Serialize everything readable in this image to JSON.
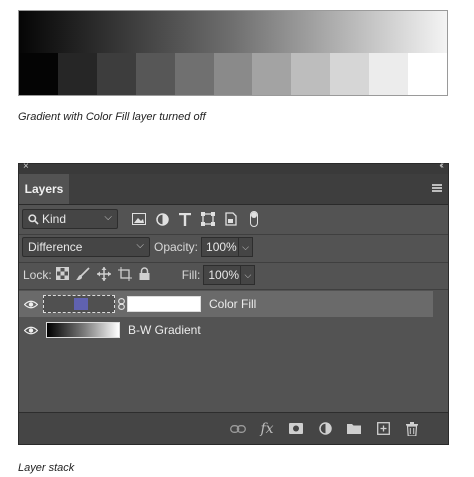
{
  "figure": {
    "caption_top": "Gradient with Color Fill layer turned off",
    "caption_bottom": "Layer stack",
    "swatches": [
      "#040404",
      "#262626",
      "#3d3d3d",
      "#575757",
      "#707070",
      "#8a8a8a",
      "#a3a3a3",
      "#bdbdbd",
      "#d6d6d6",
      "#ececec",
      "#ffffff"
    ]
  },
  "panel": {
    "tab_label": "Layers",
    "filter": {
      "kind_label": "Kind"
    },
    "blend": {
      "mode": "Difference",
      "opacity_label": "Opacity:",
      "opacity_value": "100%"
    },
    "lock": {
      "lock_label": "Lock:",
      "fill_label": "Fill:",
      "fill_value": "100%"
    },
    "layers": [
      {
        "name": "Color Fill",
        "fill_color": "#6062b0",
        "selected": true
      },
      {
        "name": "B-W Gradient",
        "selected": false
      }
    ],
    "bottom_icons": [
      "link-icon",
      "fx-icon",
      "mask-icon",
      "adjustment-icon",
      "folder-icon",
      "new-layer-icon",
      "trash-icon"
    ],
    "fx_label": "fx"
  }
}
